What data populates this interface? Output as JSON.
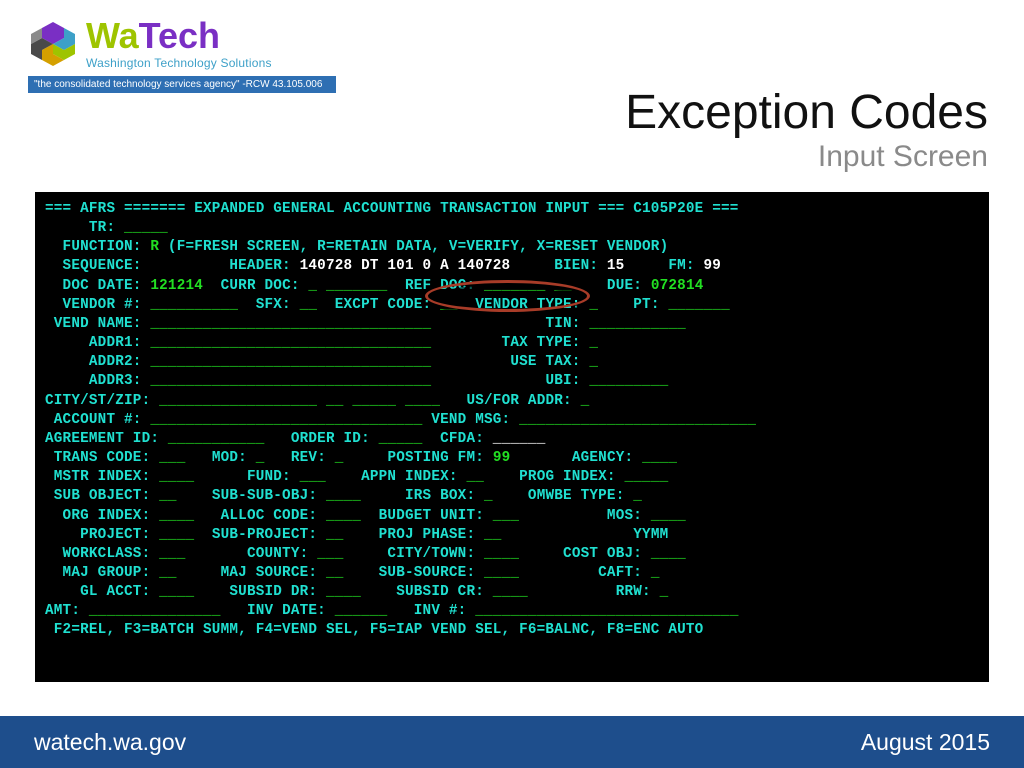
{
  "logo": {
    "wa": "Wa",
    "tech": "Tech",
    "sub": "Washington Technology Solutions",
    "tagline": "\"the consolidated technology services agency\" -RCW 43.105.006"
  },
  "title": {
    "main": "Exception Codes",
    "sub": "Input Screen"
  },
  "terminal": {
    "header1_cyan": "=== AFRS ======= EXPANDED GENERAL ACCOUNTING TRANSACTION INPUT === C105P20E ===",
    "fields": {
      "tr_label": "     TR: ",
      "tr_blank_green": "_____",
      "function_label": "  FUNCTION: ",
      "function_value": "R",
      "function_hint": " (F=FRESH SCREEN, R=RETAIN DATA, V=VERIFY, X=RESET VENDOR)",
      "sequence_label": "  SEQUENCE:          HEADER: ",
      "header_white": "140728 DT 101 0 A 140728",
      "bien_label": "     BIEN: ",
      "bien_white": "15",
      "fm_label": "     FM: ",
      "fm_white": "99",
      "docdate_label": "  DOC DATE: ",
      "docdate_green": "121214",
      "currdoc_label": "  CURR DOC: ",
      "currdoc_blank": "_ _______",
      "refdoc_label": "  REF DOC: ",
      "refdoc_blank": "_______ __",
      "due_label": "    DUE: ",
      "due_green": "072814",
      "vendor_label": "  VENDOR #: ",
      "vendor_blank": "__________",
      "sfx_label": "  SFX: ",
      "sfx_blank": "__",
      "excpt_label": "  EXCPT CODE: ",
      "excpt_blank": "__",
      "vendortype_label": "  VENDOR TYPE: ",
      "vendortype_blank": "_",
      "pt_label": "    PT: ",
      "pt_blank": "_______",
      "vendname_label": " VEND NAME: ",
      "vendname_blank": "________________________________",
      "tin_label": "             TIN: ",
      "tin_blank": "___________",
      "addr1_label": "     ADDR1: ",
      "addr1_blank": "________________________________",
      "taxtype_label": "        TAX TYPE: ",
      "taxtype_blank": "_",
      "addr2_label": "     ADDR2: ",
      "addr2_blank": "________________________________",
      "usetax_label": "         USE TAX: ",
      "usetax_blank": "_",
      "addr3_label": "     ADDR3: ",
      "addr3_blank": "________________________________",
      "ubi_label": "             UBI: ",
      "ubi_blank": "_________",
      "citystzip_label": "CITY/ST/ZIP: ",
      "city_blank": "__________________",
      "st_blank": "__",
      "zip_blank": "_____",
      "zip4_blank": "____",
      "usfor_label": "   US/FOR ADDR: ",
      "usfor_blank": "_",
      "acct_label": " ACCOUNT #: ",
      "acct_blank": "_______________________________",
      "vendmsg_label": " VEND MSG: ",
      "vendmsg_blank": "___________________________",
      "agreement_label": "AGREEMENT ID: ",
      "agreement_blank": "___________",
      "orderid_label": "   ORDER ID: ",
      "orderid_blank": "_____",
      "cfda_label": "  CFDA: ",
      "cfda_blank": "______",
      "transcode_label": " TRANS CODE: ",
      "transcode_blank": "___",
      "mod_label": "   MOD: ",
      "mod_blank": "_",
      "rev_label": "   REV: ",
      "rev_blank": "_",
      "postingfm_label": "     POSTING FM: ",
      "postingfm_green": "99",
      "agency_label": "       AGENCY: ",
      "agency_blank": "____",
      "mstrindex_label": " MSTR INDEX: ",
      "mstrindex_blank": "____",
      "fund_label": "      FUND: ",
      "fund_blank": "___",
      "appnindex_label": "    APPN INDEX: ",
      "appnindex_blank": "__",
      "progindex_label": "    PROG INDEX: ",
      "progindex_blank": "_____",
      "subobject_label": " SUB OBJECT: ",
      "subobject_blank": "__",
      "subsubobj_label": "    SUB-SUB-OBJ: ",
      "subsubobj_blank": "____",
      "irsbox_label": "     IRS BOX: ",
      "irsbox_blank": "_",
      "omwbe_label": "    OMWBE TYPE: ",
      "omwbe_blank": "_",
      "orgindex_label": "  ORG INDEX: ",
      "orgindex_blank": "____",
      "alloccode_label": "   ALLOC CODE: ",
      "alloccode_blank": "____",
      "budgetunit_label": "  BUDGET UNIT: ",
      "budgetunit_blank": "___",
      "mos_label": "          MOS: ",
      "mos_blank": "____",
      "project_label": "    PROJECT: ",
      "project_blank": "____",
      "subproject_label": "  SUB-PROJECT: ",
      "subproject_blank": "__",
      "projphase_label": "    PROJ PHASE: ",
      "projphase_blank": "__",
      "yymm_label": "               YYMM",
      "workclass_label": "  WORKCLASS: ",
      "workclass_blank": "___",
      "county_label": "       COUNTY: ",
      "county_blank": "___",
      "citytown_label": "     CITY/TOWN: ",
      "citytown_blank": "____",
      "costobj_label": "     COST OBJ: ",
      "costobj_blank": "____",
      "majgroup_label": "  MAJ GROUP: ",
      "majgroup_blank": "__",
      "majsource_label": "     MAJ SOURCE: ",
      "majsource_blank": "__",
      "subsource_label": "    SUB-SOURCE: ",
      "subsource_blank": "____",
      "caft_label": "         CAFT: ",
      "caft_blank": "_",
      "glacct_label": "    GL ACCT: ",
      "glacct_blank": "____",
      "subsiddr_label": "    SUBSID DR: ",
      "subsiddr_blank": "____",
      "subsidcr_label": "    SUBSID CR: ",
      "subsidcr_blank": "____",
      "rrw_label": "          RRW: ",
      "rrw_blank": "_",
      "amt_label": "AMT: ",
      "amt_blank": "_______________",
      "invdate_label": "   INV DATE: ",
      "invdate_blank": "______",
      "invnum_label": "   INV #: ",
      "invnum_blank": "______________________________",
      "fkeys": " F2=REL, F3=BATCH SUMM, F4=VEND SEL, F5=IAP VEND SEL, F6=BALNC, F8=ENC AUTO"
    }
  },
  "footer": {
    "left": "watech.wa.gov",
    "right": "August 2015"
  }
}
